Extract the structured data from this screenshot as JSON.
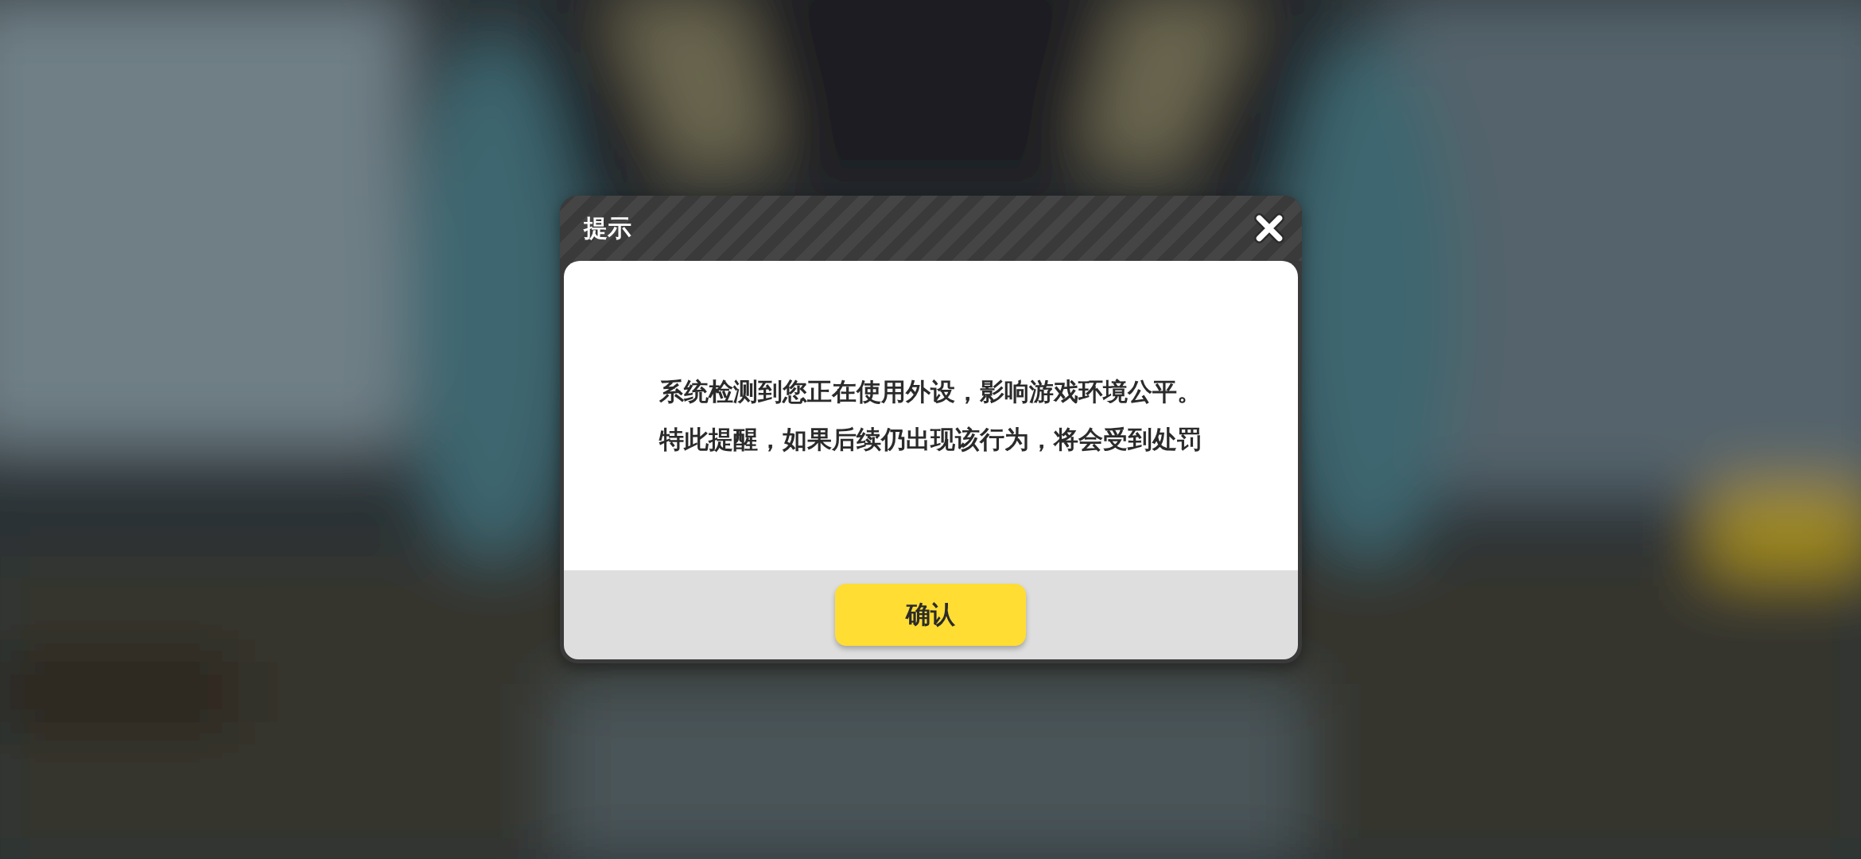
{
  "dialog": {
    "title": "提示",
    "message_lines": [
      "系统检测到您正在使用外设，影响游戏环境公平。",
      "特此提醒，如果后续仍出现该行为，将会受到处罚"
    ],
    "confirm_button": "确认"
  }
}
